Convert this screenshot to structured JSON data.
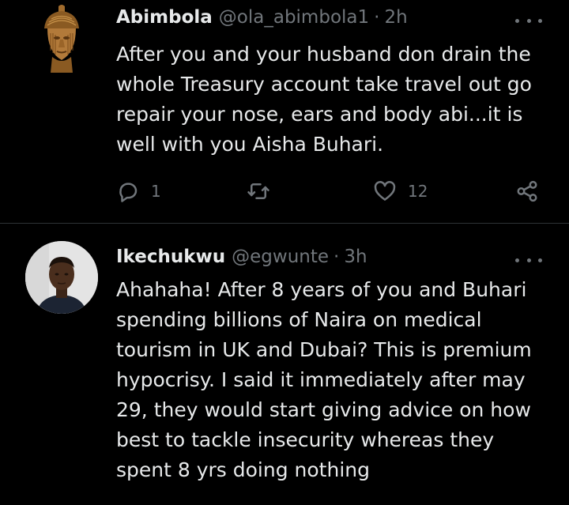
{
  "tweets": [
    {
      "name": "Abimbola",
      "handle": "@ola_abimbola1",
      "separator": "·",
      "time": "2h",
      "text": "After you and your husband don drain the whole Treasury account take travel out go repair your nose, ears and body abi...it is well with you Aisha Buhari.",
      "reply_count": "1",
      "like_count": "12"
    },
    {
      "name": "Ikechukwu",
      "handle": "@egwunte",
      "separator": "·",
      "time": "3h",
      "text": "Ahahaha! After 8 years of you and Buhari spending billions of Naira on medical tourism in UK and Dubai? This is premium hypocrisy. I said it immediately after may 29, they would start giving advice on how best to tackle insecurity whereas they spent 8 yrs doing nothing"
    }
  ],
  "icons": {
    "reply": "reply-icon",
    "retweet": "retweet-icon",
    "like": "like-icon",
    "share": "share-icon",
    "more": "more-icon"
  },
  "colors": {
    "background": "#000000",
    "text": "#e7e9ea",
    "secondary": "#71767b",
    "divider": "#2f3336"
  }
}
